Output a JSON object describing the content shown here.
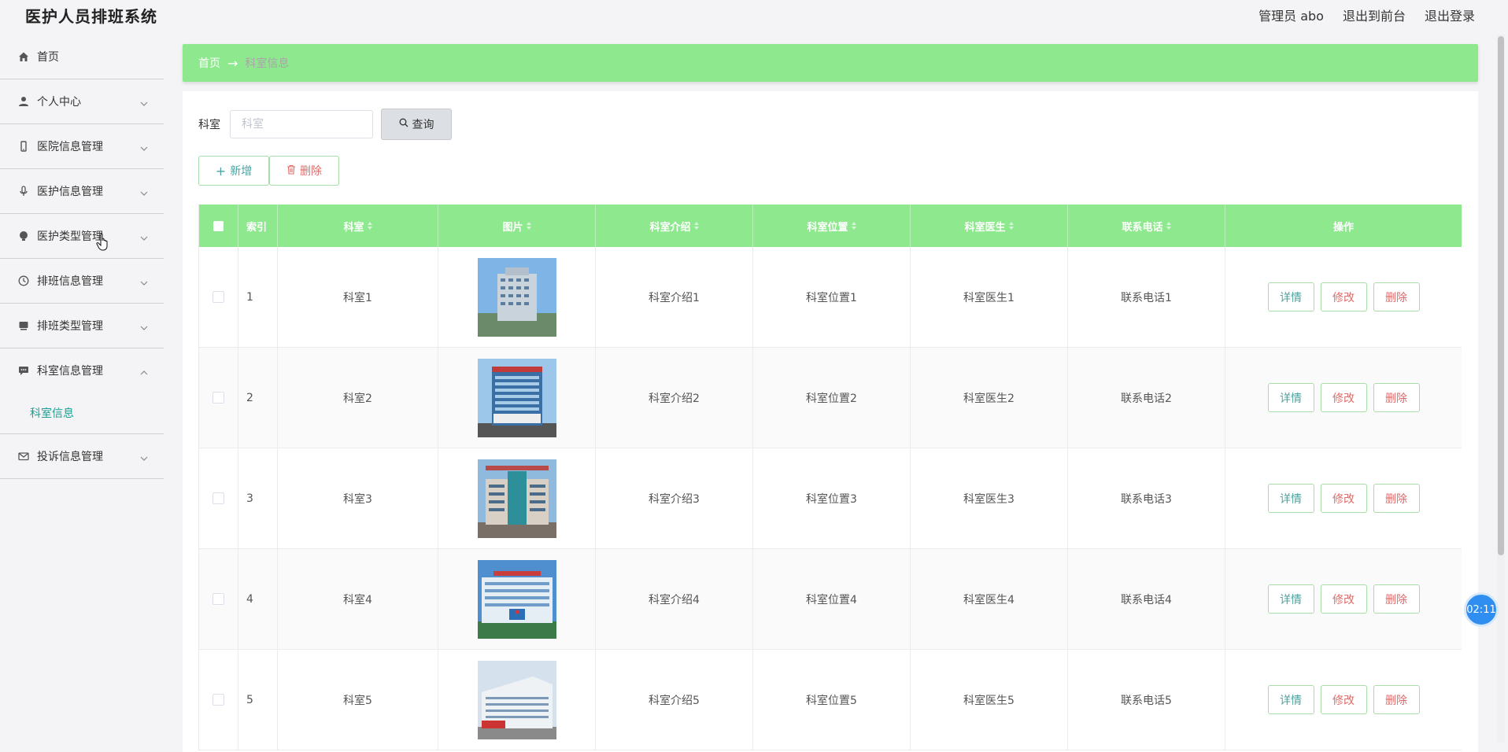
{
  "app": {
    "title": "医护人员排班系统"
  },
  "header": {
    "user": "管理员 abo",
    "front": "退出到前台",
    "logout": "退出登录"
  },
  "sidebar": {
    "items": [
      {
        "label": "首页",
        "icon": "home-icon",
        "expandable": false
      },
      {
        "label": "个人中心",
        "icon": "user-icon",
        "expandable": true
      },
      {
        "label": "医院信息管理",
        "icon": "phone-icon",
        "expandable": true
      },
      {
        "label": "医护信息管理",
        "icon": "microphone-icon",
        "expandable": true
      },
      {
        "label": "医护类型管理",
        "icon": "bulb-icon",
        "expandable": true
      },
      {
        "label": "排班信息管理",
        "icon": "clock-icon",
        "expandable": true
      },
      {
        "label": "排班类型管理",
        "icon": "monitor-icon",
        "expandable": true
      },
      {
        "label": "科室信息管理",
        "icon": "chat-icon",
        "expandable": true,
        "expanded": true
      },
      {
        "label": "投诉信息管理",
        "icon": "mail-icon",
        "expandable": true
      }
    ],
    "sub_active": "科室信息"
  },
  "breadcrumb": {
    "home": "首页",
    "arrow": "→",
    "current": "科室信息"
  },
  "search": {
    "label": "科室",
    "placeholder": "科室",
    "button": "查询"
  },
  "actions": {
    "add": "新增",
    "delete": "删除"
  },
  "table": {
    "headers": [
      "索引",
      "科室",
      "图片",
      "科室介绍",
      "科室位置",
      "科室医生",
      "联系电话",
      "操作"
    ],
    "rows": [
      {
        "index": "1",
        "dept": "科室1",
        "intro": "科室介绍1",
        "location": "科室位置1",
        "doctor": "科室医生1",
        "phone": "联系电话1"
      },
      {
        "index": "2",
        "dept": "科室2",
        "intro": "科室介绍2",
        "location": "科室位置2",
        "doctor": "科室医生2",
        "phone": "联系电话2"
      },
      {
        "index": "3",
        "dept": "科室3",
        "intro": "科室介绍3",
        "location": "科室位置3",
        "doctor": "科室医生3",
        "phone": "联系电话3"
      },
      {
        "index": "4",
        "dept": "科室4",
        "intro": "科室介绍4",
        "location": "科室位置4",
        "doctor": "科室医生4",
        "phone": "联系电话4"
      },
      {
        "index": "5",
        "dept": "科室5",
        "intro": "科室介绍5",
        "location": "科室位置5",
        "doctor": "科室医生5",
        "phone": "联系电话5"
      }
    ],
    "ops": {
      "detail": "详情",
      "edit": "修改",
      "delete": "删除"
    }
  },
  "timer": "02:11",
  "colors": {
    "accent_green": "#8ee88e",
    "teal": "#1aa094",
    "danger": "#e06a6a"
  }
}
